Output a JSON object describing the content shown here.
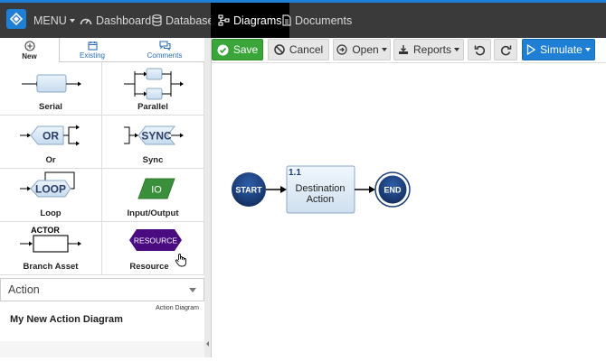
{
  "topbar": {
    "menu_label": "MENU",
    "items": [
      {
        "label": "Dashboard",
        "icon": "dashboard-icon"
      },
      {
        "label": "Database",
        "icon": "database-icon"
      },
      {
        "label": "Diagrams",
        "icon": "diagram-icon",
        "active": true
      },
      {
        "label": "Documents",
        "icon": "document-icon"
      }
    ]
  },
  "left_tabs": [
    {
      "label": "New",
      "icon": "plus-circle-icon",
      "active": true
    },
    {
      "label": "Existing",
      "icon": "calendar-icon"
    },
    {
      "label": "Comments",
      "icon": "comments-icon"
    }
  ],
  "palette": [
    {
      "label": "Serial"
    },
    {
      "label": "Parallel"
    },
    {
      "label": "Or",
      "shape_text": "OR"
    },
    {
      "label": "Sync",
      "shape_text": "SYNC"
    },
    {
      "label": "Loop",
      "shape_text": "LOOP"
    },
    {
      "label": "Input/Output",
      "shape_text": "IO"
    },
    {
      "label": "Branch Asset",
      "shape_text": "ACTOR"
    },
    {
      "label": "Resource",
      "shape_text": "RESOURCE"
    }
  ],
  "type_select": {
    "value": "Action"
  },
  "document": {
    "type": "Action Diagram",
    "name": "My New Action Diagram"
  },
  "toolbar": {
    "save": "Save",
    "cancel": "Cancel",
    "open": "Open",
    "reports": "Reports",
    "simulate": "Simulate"
  },
  "diagram": {
    "start": "START",
    "end": "END",
    "action_number": "1.1",
    "action_line1": "Destination",
    "action_line2": "Action"
  },
  "colors": {
    "accent": "#1e7fd4",
    "topbar": "#3a3a3a",
    "save_green": "#3aa63a",
    "node_navy": "#1b3f7a",
    "io_green": "#3a8f3a",
    "resource_purple": "#4a0a80"
  }
}
